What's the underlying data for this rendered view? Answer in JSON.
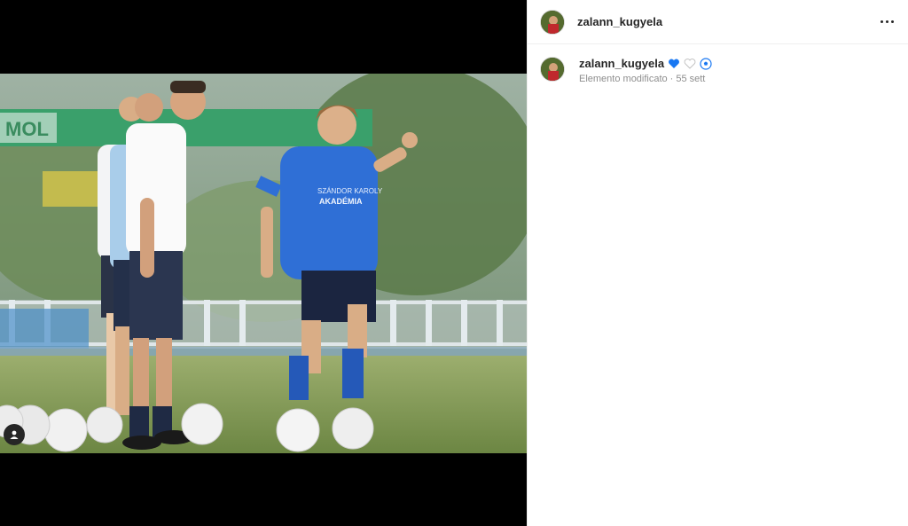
{
  "post": {
    "username": "zalann_kugyela"
  },
  "caption": {
    "username": "zalann_kugyela",
    "emojis": [
      "blue-heart",
      "white-heart",
      "soccer-ball"
    ],
    "edited_label": "Elemento modificato",
    "separator": "·",
    "time": "55 sett"
  },
  "photo": {
    "shirt_text_line1": "SZÁNDOR KAROLY",
    "shirt_text_line2": "AKADÉMIA",
    "banner_text": "MOL"
  },
  "colors": {
    "accent_blue": "#1877f2",
    "kit_blue": "#2f6fd6",
    "text_dark": "#262626",
    "text_muted": "#8e8e8e"
  }
}
